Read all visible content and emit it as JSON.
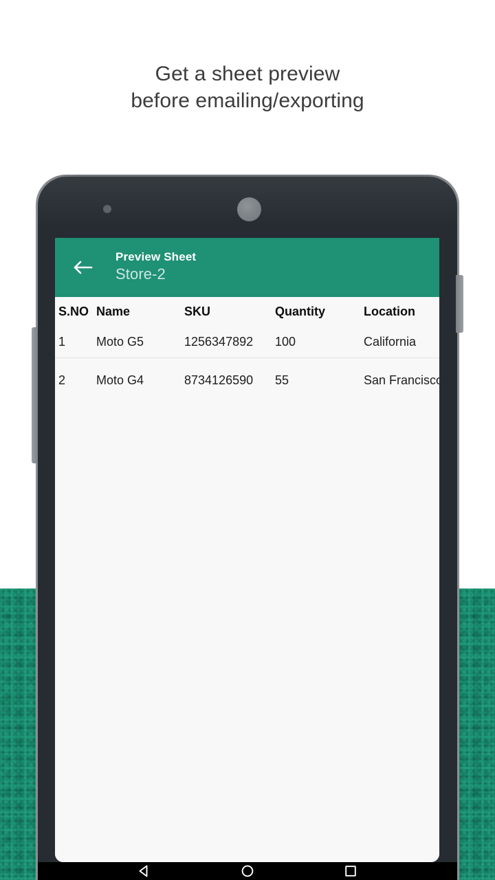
{
  "promo": {
    "headline_line1": "Get a sheet preview",
    "headline_line2": "before emailing/exporting",
    "headline_color": "#3c3c3c",
    "background_color": "#1e9a79"
  },
  "device": {
    "frame_color": "#262c31",
    "nav": {
      "back_label": "Back",
      "home_label": "Home",
      "recents_label": "Recent apps"
    }
  },
  "app": {
    "accent_color": "#1f9175",
    "appbar": {
      "back_icon": "arrow-left-icon",
      "title": "Preview Sheet",
      "subtitle": "Store-2"
    },
    "sheet": {
      "columns": [
        "S.NO",
        "Name",
        "SKU",
        "Quantity",
        "Location"
      ],
      "rows": [
        {
          "sno": "1",
          "name": "Moto G5",
          "sku": "1256347892",
          "quantity": "100",
          "location": "California"
        },
        {
          "sno": "2",
          "name": "Moto G4",
          "sku": "8734126590",
          "quantity": "55",
          "location": "San Francisco"
        }
      ]
    }
  }
}
